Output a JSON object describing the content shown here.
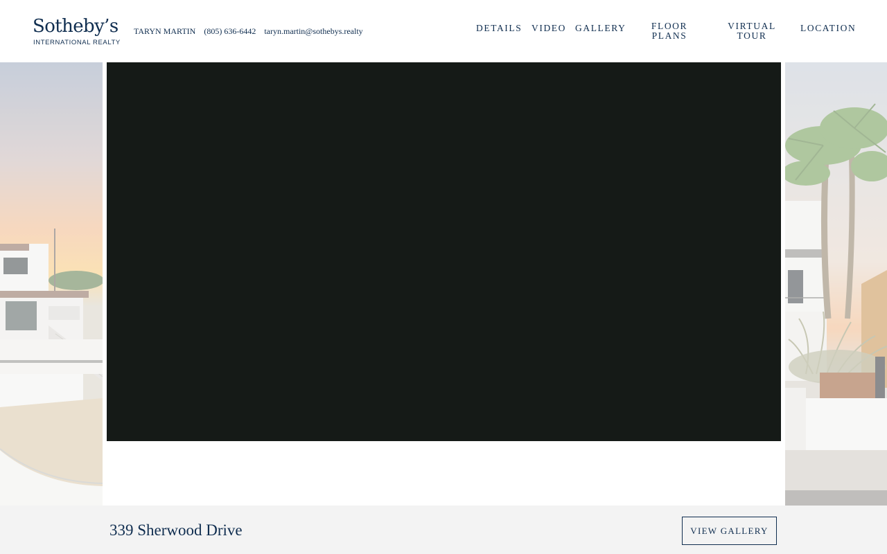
{
  "brand": {
    "name": "Sotheby’s",
    "subtitle": "INTERNATIONAL REALTY",
    "color": "#0f2d4f"
  },
  "agent": {
    "name": "TARYN MARTIN",
    "phone": "(805) 636-6442",
    "email": "taryn.martin@sothebys.realty"
  },
  "nav": {
    "details": "DETAILS",
    "video": "VIDEO",
    "gallery": "GALLERY",
    "floor_plans": "FLOOR PLANS",
    "virtual_tour": "VIRTUAL TOUR",
    "location": "LOCATION"
  },
  "hero": {
    "video_background": "#151a17",
    "left_preview": "house-exterior-sunset-photo",
    "right_preview": "palm-tree-driveway-photo"
  },
  "listing": {
    "address": "339 Sherwood Drive",
    "view_gallery_label": "VIEW GALLERY"
  }
}
